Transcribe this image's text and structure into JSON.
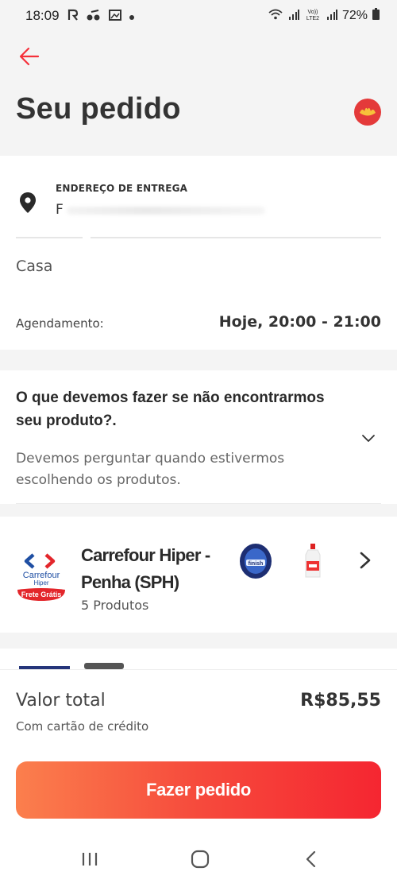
{
  "status_bar": {
    "time": "18:09",
    "left_icons": [
      "rappi-notification-icon",
      "music-notification-icon",
      "gallery-notification-icon",
      "dot-icon"
    ],
    "right_icons": [
      "wifi-icon",
      "signal-icon",
      "volte-icon",
      "signal-icon",
      "battery-icon"
    ],
    "volte_text": "Vo)) LTE2",
    "battery": "72%"
  },
  "header": {
    "title": "Seu pedido"
  },
  "address": {
    "label": "ENDEREÇO DE ENTREGA",
    "value": "F",
    "name": "Casa",
    "schedule_label": "Agendamento:",
    "schedule_value": "Hoje, 20:00 - 21:00"
  },
  "preferences": {
    "question": "O que devemos fazer se não encontrarmos seu produto?.",
    "answer": "Devemos perguntar quando estivermos escolhendo os produtos."
  },
  "store": {
    "name": "Carrefour Hiper - Penha (SPH)",
    "count": "5 Produtos",
    "logo_text": "Carrefour",
    "logo_sub": "Hiper",
    "logo_badge": "Frete Grátis",
    "thumb_label": "finish"
  },
  "footer": {
    "total_label": "Valor total",
    "total_value": "R$85,55",
    "payment": "Com cartão de crédito",
    "order_button": "Fazer pedido"
  },
  "colors": {
    "accent": "#f5303a",
    "button_start": "#fb7f4d",
    "button_end": "#f52631"
  }
}
